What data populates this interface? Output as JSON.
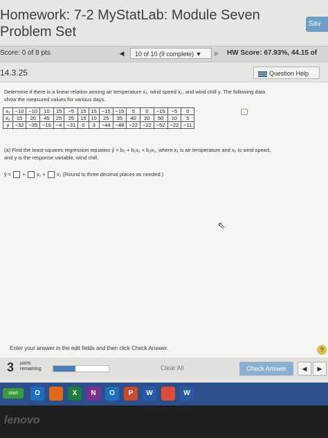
{
  "header": {
    "title_line1": "Homework: 7-2 MyStatLab: Module Seven",
    "title_line2": "Problem Set",
    "save_label": "Sav"
  },
  "scorebar": {
    "score": "Score: 0 of 8 pts",
    "prev": "◀",
    "question_select": "10 of 10 (9 complete) ▼",
    "next": "▶",
    "hw_score": "HW Score: 67.93%, 44.15 of"
  },
  "question": {
    "id": "14.3.25",
    "help_label": "Question Help",
    "prompt_line1": "Determine if there is a linear relation among air temperature x₁, wind speed x₂, and wind chill y. The following data",
    "prompt_line2": "show the measured values for various days.",
    "table": {
      "rows": [
        [
          "x₁",
          "−10",
          "−10",
          "10",
          "15",
          "−5",
          "15",
          "15",
          "−15",
          "−15",
          "5",
          "0",
          "−15",
          "−5",
          "0"
        ],
        [
          "x₂",
          "15",
          "20",
          "45",
          "25",
          "25",
          "15",
          "10",
          "25",
          "35",
          "40",
          "20",
          "50",
          "10",
          "5"
        ],
        [
          "y",
          "−32",
          "−35",
          "−16",
          "−4",
          "−31",
          "0",
          "3",
          "−44",
          "−48",
          "−22",
          "−22",
          "−52",
          "−22",
          "−11"
        ]
      ]
    },
    "part_a_line1": "(a) Find the least-squares regression equation ŷ = b₀ + b₁x₁ + b₂x₂, where x₁ is air temperature and x₂ is wind speed,",
    "part_a_line2": "and y is the response variable, wind chill.",
    "eq_prefix": "ŷ =",
    "eq_plus1": "+",
    "eq_x1": "x₁ +",
    "eq_x2": "x₂",
    "eq_note": "(Round to three decimal places as needed.)"
  },
  "footer": {
    "message": "Enter your answer in the edit fields and then click Check Answer.",
    "help": "?",
    "parts_count": "3",
    "parts_label_line1": "parts",
    "parts_label_line2": "remaining",
    "progress_fraction": 0.4,
    "clear_all": "Clear All",
    "check_answer": "Check Answer",
    "page_prev": "◀",
    "page_next": "▶"
  },
  "taskbar": {
    "start": "start",
    "apps": [
      {
        "icon": "outlook-icon",
        "label": "O",
        "color": "#1f6fc1"
      },
      {
        "icon": "firefox-icon",
        "label": "",
        "color": "#e06a1b"
      },
      {
        "icon": "excel-icon",
        "label": "X",
        "color": "#1f7a3e"
      },
      {
        "icon": "onenote-icon",
        "label": "N",
        "color": "#7b2f8f"
      },
      {
        "icon": "outlook2-icon",
        "label": "O",
        "color": "#1f6fc1"
      },
      {
        "icon": "powerpoint-icon",
        "label": "P",
        "color": "#c84a2a"
      },
      {
        "icon": "word-icon",
        "label": "W",
        "color": "#2a5aa6"
      },
      {
        "icon": "chrome-icon",
        "label": "",
        "color": "#d94f3a"
      },
      {
        "icon": "word2-icon",
        "label": "W",
        "color": "#2a5aa6"
      }
    ]
  },
  "bezel": {
    "brand": "lenovo"
  }
}
